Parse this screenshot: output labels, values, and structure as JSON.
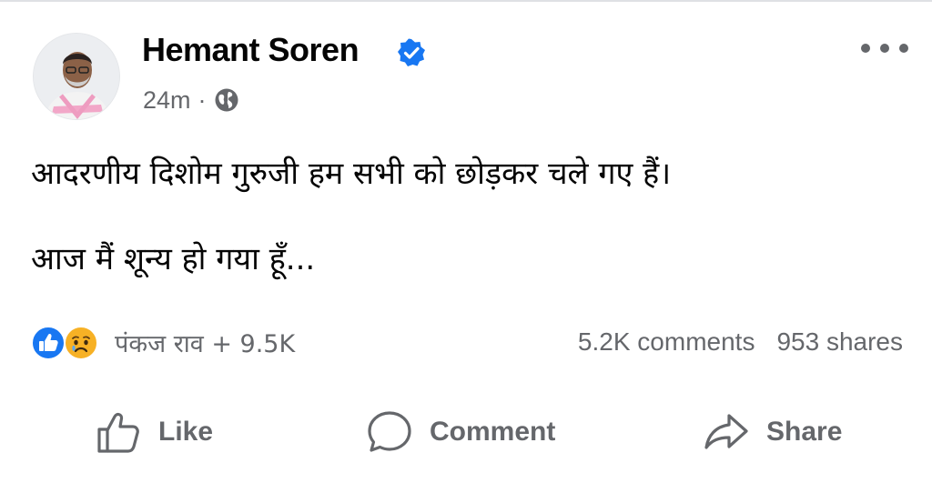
{
  "post": {
    "author": "Hemant Soren",
    "time": "24m",
    "separator": "·",
    "icons": {
      "verified": "verified-badge-icon",
      "audience": "globe-icon",
      "menu": "more-options-icon"
    },
    "lines": [
      "आदरणीय दिशोम गुरुजी हम सभी को छोड़कर चले गए हैं।",
      "आज मैं शून्य हो गया हूँ..."
    ]
  },
  "engagement": {
    "reactions_text": "पंकज राव + 9.5K",
    "reaction_icons": [
      "like-reaction-icon",
      "sad-reaction-icon"
    ],
    "comments": "5.2K comments",
    "shares": "953 shares"
  },
  "actions": {
    "like": "Like",
    "comment": "Comment",
    "share": "Share"
  },
  "colors": {
    "accent": "#1877f2",
    "secondary_text": "#65676b",
    "primary_text": "#050505",
    "sad_emoji": "#f7b125"
  }
}
